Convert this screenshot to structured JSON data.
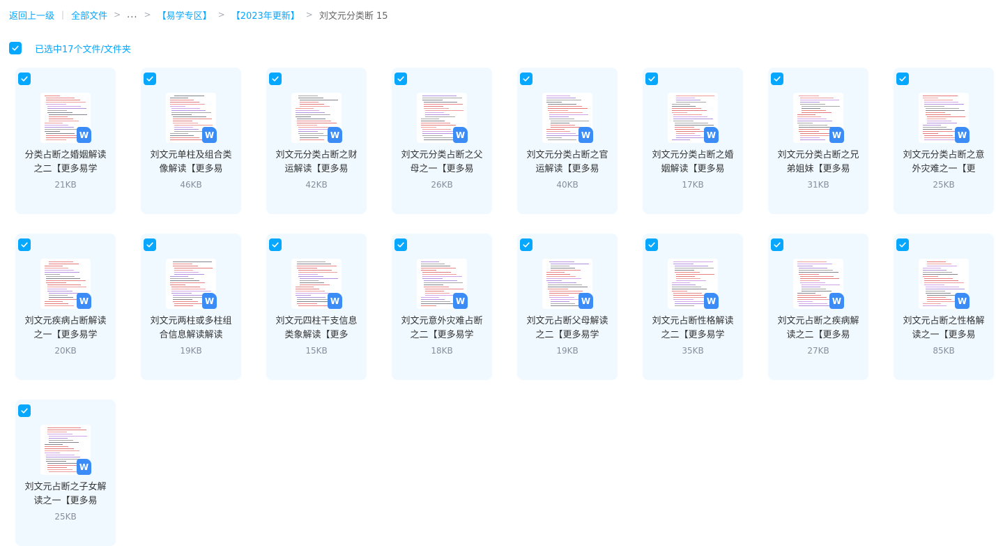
{
  "breadcrumb": {
    "back": "返回上一级",
    "root": "全部文件",
    "ellipsis": "...",
    "folder1": "【易学专区】",
    "folder2": "【2023年更新】",
    "current": "刘文元分类断 15"
  },
  "selection": {
    "label": "已选中17个文件/文件夹",
    "checked": true
  },
  "colors": {
    "accent": "#06a7ff",
    "card_bg": "#f0f9ff",
    "doc_icon": "#3c8cf7"
  },
  "file_icon_letter": "W",
  "files": [
    {
      "name": "分类占断之婚姻解读之二【更多易学",
      "size": "21KB",
      "checked": true
    },
    {
      "name": "刘文元单柱及组合类像解读【更多易",
      "size": "46KB",
      "checked": true
    },
    {
      "name": "刘文元分类占断之财运解读【更多易",
      "size": "42KB",
      "checked": true
    },
    {
      "name": "刘文元分类占断之父母之一【更多易",
      "size": "26KB",
      "checked": true
    },
    {
      "name": "刘文元分类占断之官运解读【更多易",
      "size": "40KB",
      "checked": true
    },
    {
      "name": "刘文元分类占断之婚姻解读【更多易",
      "size": "17KB",
      "checked": true
    },
    {
      "name": "刘文元分类占断之兄弟姐妹【更多易",
      "size": "31KB",
      "checked": true
    },
    {
      "name": "刘文元分类占断之意外灾难之一【更",
      "size": "25KB",
      "checked": true
    },
    {
      "name": "刘文元疾病占断解读之一【更多易学",
      "size": "20KB",
      "checked": true
    },
    {
      "name": "刘文元两柱或多柱组合信息解读解读",
      "size": "19KB",
      "checked": true
    },
    {
      "name": "刘文元四柱干支信息类象解读【更多",
      "size": "15KB",
      "checked": true
    },
    {
      "name": "刘文元意外灾难占断之二【更多易学",
      "size": "18KB",
      "checked": true
    },
    {
      "name": "刘文元占断父母解读之二【更多易学",
      "size": "19KB",
      "checked": true
    },
    {
      "name": "刘文元占断性格解读之二【更多易学",
      "size": "35KB",
      "checked": true
    },
    {
      "name": "刘文元占断之疾病解读之二【更多易",
      "size": "27KB",
      "checked": true
    },
    {
      "name": "刘文元占断之性格解读之一【更多易",
      "size": "85KB",
      "checked": true
    },
    {
      "name": "刘文元占断之子女解读之一【更多易",
      "size": "25KB",
      "checked": true
    }
  ]
}
